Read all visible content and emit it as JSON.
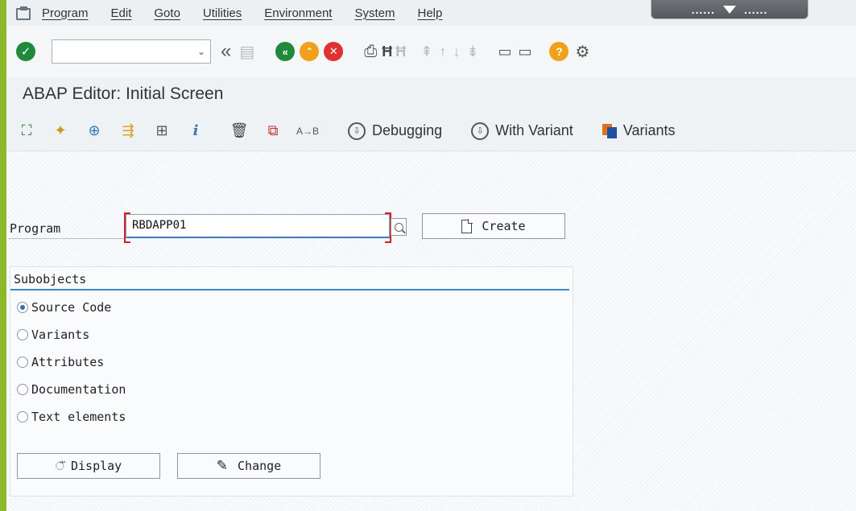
{
  "menubar": {
    "items": [
      "Program",
      "Edit",
      "Goto",
      "Utilities",
      "Environment",
      "System",
      "Help"
    ],
    "window_control_dots": "......"
  },
  "toolbar": {
    "command_field": {
      "value": "",
      "placeholder": ""
    },
    "icons": [
      "enter-check-icon",
      "back-double-chevron-icon",
      "save-icon",
      "back-icon",
      "exit-icon",
      "cancel-icon",
      "print-icon",
      "find-icon",
      "find-next-icon",
      "first-page-icon",
      "previous-page-icon",
      "next-page-icon",
      "last-page-icon",
      "new-session-icon",
      "shortcut-icon",
      "help-icon",
      "settings-icon"
    ]
  },
  "title": "ABAP Editor: Initial Screen",
  "app_toolbar": {
    "debugging_label": "Debugging",
    "with_variant_label": "With Variant",
    "variants_label": "Variants"
  },
  "form": {
    "program_label": "Program",
    "program_value": "RBDAPP01",
    "create_label": "Create"
  },
  "subobjects": {
    "title": "Subobjects",
    "options": [
      "Source Code",
      "Variants",
      "Attributes",
      "Documentation",
      "Text elements"
    ],
    "selected": "Source Code"
  },
  "actions": {
    "display_label": "Display",
    "change_label": "Change"
  },
  "colors": {
    "accent_green": "#8cb82a",
    "ok_green": "#1f8a3b",
    "exit_orange": "#f0a01a",
    "cancel_red": "#e03030",
    "focus_blue": "#3a7ab8"
  }
}
